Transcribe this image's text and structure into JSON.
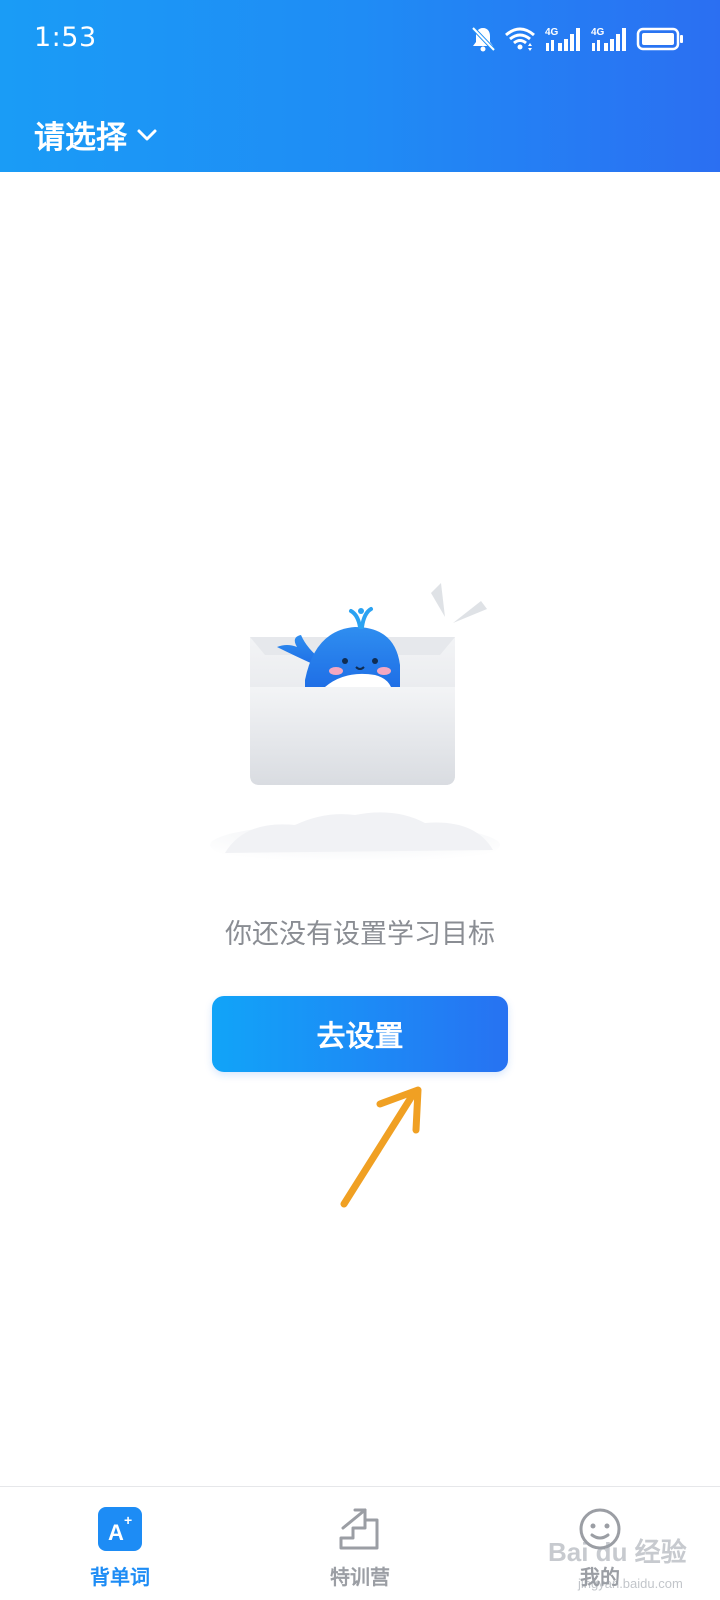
{
  "status_bar": {
    "time": "1:53",
    "network_left": "4G",
    "network_right": "4G",
    "icons": [
      "mute-bell-icon",
      "wifi-icon",
      "signal-4g-icon",
      "signal-4g-icon",
      "battery-icon"
    ]
  },
  "header": {
    "title": "请选择",
    "dropdown_icon": "chevron-down-icon"
  },
  "empty_state": {
    "message": "你还没有设置学习目标",
    "button_label": "去设置",
    "illustration": "whale-in-box"
  },
  "bottom_nav": {
    "items": [
      {
        "label": "背单词",
        "icon": "vocab-a-plus-icon",
        "active": true
      },
      {
        "label": "特训营",
        "icon": "stairs-up-icon",
        "active": false
      },
      {
        "label": "我的",
        "icon": "smiley-face-icon",
        "active": false
      }
    ]
  },
  "watermark": {
    "brand": "Bai du 经验",
    "url": "jingyan.baidu.com"
  },
  "colors": {
    "header_gradient_start": "#1a9cf6",
    "header_gradient_end": "#2b6ff2",
    "active_nav": "#1d8cf5",
    "inactive_nav": "#9b9ea4",
    "message_text": "#8a8d93",
    "arrow": "#f0a023"
  }
}
